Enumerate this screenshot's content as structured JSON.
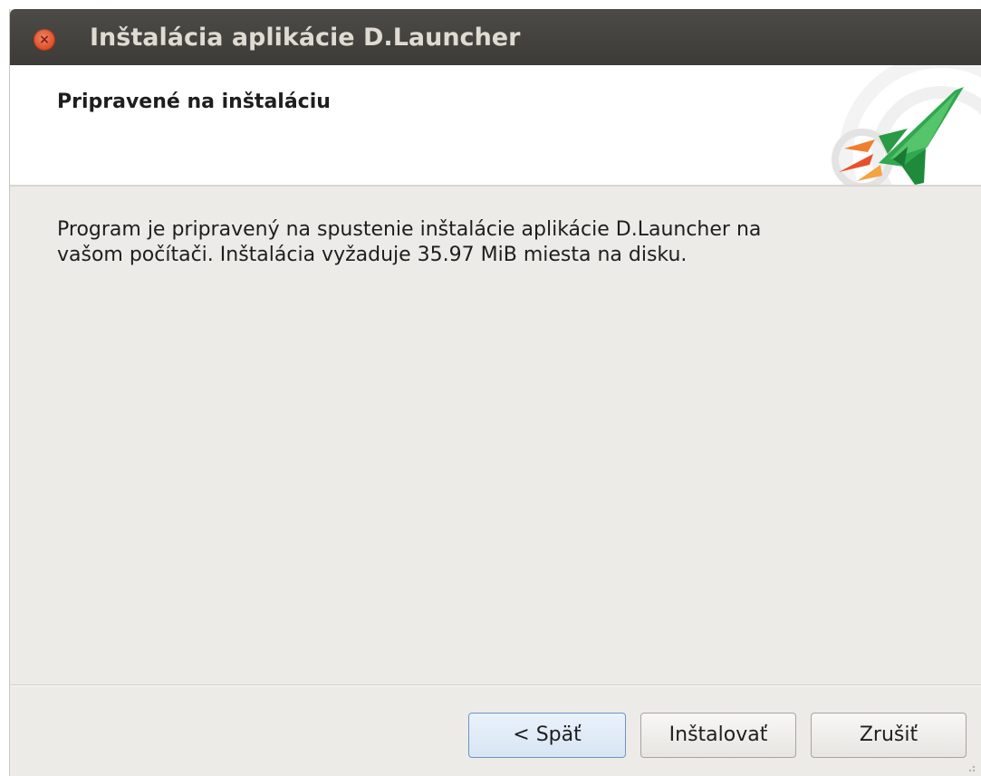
{
  "window": {
    "title": "Inštalácia aplikácie D.Launcher"
  },
  "header": {
    "title": "Pripravené na inštaláciu"
  },
  "main": {
    "line1": "Program je pripravený na spustenie inštalácie aplikácie D.Launcher na",
    "line2": "vašom počítači. Inštalácia vyžaduje 35.97 MiB miesta na disku."
  },
  "buttons": {
    "back": "< Späť",
    "install": "Inštalovať",
    "cancel": "Zrušiť"
  },
  "icons": {
    "close": "close-icon",
    "logo": "rocket-logo-icon"
  },
  "colors": {
    "titlebar": "#3c3b37",
    "close": "#df4a20",
    "rocket": "#2fa84f",
    "dialog": "#edebe8"
  }
}
